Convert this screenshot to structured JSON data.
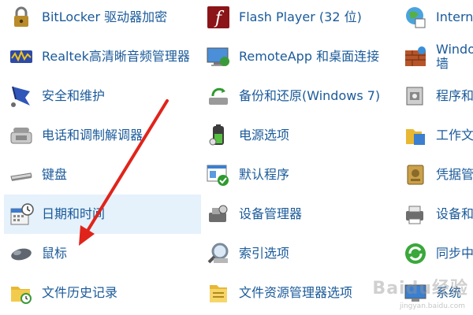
{
  "columns": [
    {
      "items": [
        {
          "label": "BitLocker 驱动器加密",
          "icon": "bitlocker-icon"
        },
        {
          "label": "Realtek高清晰音频管理器",
          "icon": "realtek-audio-icon"
        },
        {
          "label": "安全和维护",
          "icon": "security-flag-icon"
        },
        {
          "label": "电话和调制解调器",
          "icon": "phone-modem-icon"
        },
        {
          "label": "键盘",
          "icon": "keyboard-icon"
        },
        {
          "label": "日期和时间",
          "icon": "calendar-clock-icon",
          "selected": true
        },
        {
          "label": "鼠标",
          "icon": "mouse-icon"
        },
        {
          "label": "文件历史记录",
          "icon": "file-history-icon"
        }
      ]
    },
    {
      "items": [
        {
          "label": "Flash Player (32 位)",
          "icon": "flash-player-icon"
        },
        {
          "label": "RemoteApp 和桌面连接",
          "icon": "remoteapp-icon"
        },
        {
          "label": "备份和还原(Windows 7)",
          "icon": "backup-restore-icon"
        },
        {
          "label": "电源选项",
          "icon": "battery-power-icon"
        },
        {
          "label": "默认程序",
          "icon": "default-programs-icon"
        },
        {
          "label": "设备管理器",
          "icon": "device-manager-icon"
        },
        {
          "label": "索引选项",
          "icon": "indexing-magnifier-icon"
        },
        {
          "label": "文件资源管理器选项",
          "icon": "folder-options-icon"
        }
      ]
    },
    {
      "items": [
        {
          "label": "Interne",
          "icon": "internet-options-icon"
        },
        {
          "label": "Windo\n墙",
          "icon": "firewall-icon"
        },
        {
          "label": "程序和",
          "icon": "programs-features-icon"
        },
        {
          "label": "工作文",
          "icon": "work-folders-icon"
        },
        {
          "label": "凭据管",
          "icon": "credential-manager-icon"
        },
        {
          "label": "设备和",
          "icon": "devices-printers-icon"
        },
        {
          "label": "同步中",
          "icon": "sync-center-icon"
        },
        {
          "label": "系统",
          "icon": "system-icon"
        }
      ]
    }
  ],
  "watermark": {
    "text": "Baidu经验",
    "sub": "jingyan.baidu.com"
  },
  "colors": {
    "link": "#1a5a9a",
    "selected_bg": "#e5f1fb",
    "arrow": "#e0241b"
  }
}
